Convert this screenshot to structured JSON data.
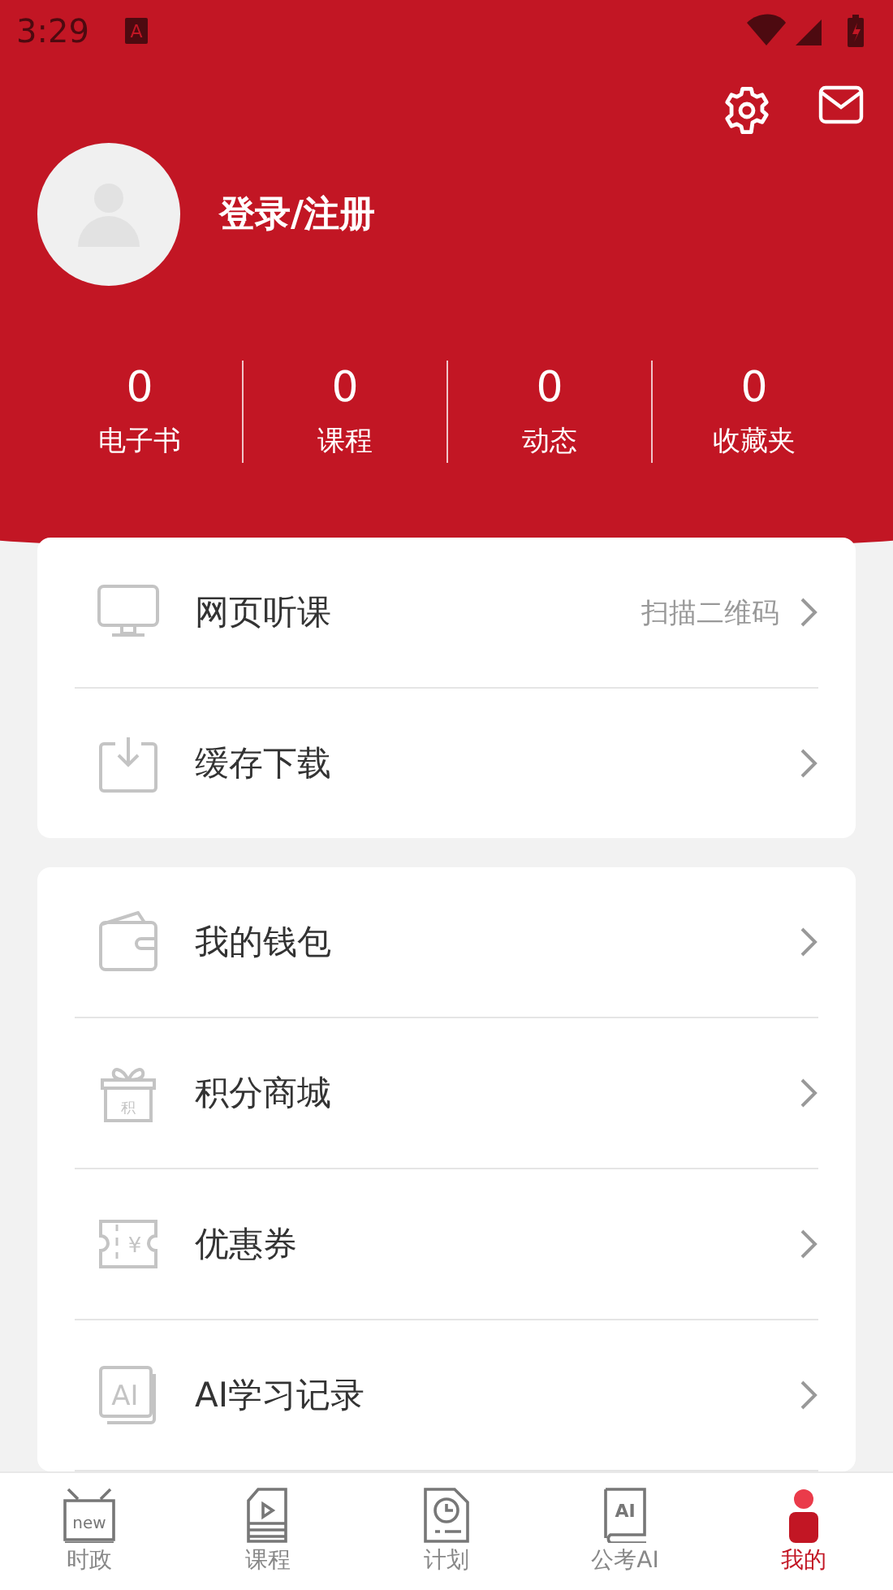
{
  "status_bar": {
    "time": "3:29",
    "notification_icon_text": "A"
  },
  "header": {
    "login_label": "登录/注册"
  },
  "stats": [
    {
      "value": "0",
      "label": "电子书"
    },
    {
      "value": "0",
      "label": "课程"
    },
    {
      "value": "0",
      "label": "动态"
    },
    {
      "value": "0",
      "label": "收藏夹"
    }
  ],
  "menu_groups": [
    [
      {
        "kind": "monitor",
        "label": "网页听课",
        "hint": "扫描二维码"
      },
      {
        "kind": "download",
        "label": "缓存下载"
      }
    ],
    [
      {
        "kind": "wallet",
        "label": "我的钱包"
      },
      {
        "kind": "gift",
        "label": "积分商城",
        "icon_text": "积"
      },
      {
        "kind": "coupon",
        "label": "优惠券",
        "icon_text": "¥"
      },
      {
        "kind": "ai",
        "label": "AI学习记录",
        "icon_text": "AI"
      }
    ]
  ],
  "bottom_nav": [
    {
      "kind": "tv",
      "label": "时政",
      "icon_text": "new",
      "selected": false
    },
    {
      "kind": "course",
      "label": "课程",
      "selected": false
    },
    {
      "kind": "plan",
      "label": "计划",
      "selected": false
    },
    {
      "kind": "book",
      "label": "公考AI",
      "icon_text": "AI",
      "selected": false
    },
    {
      "kind": "person",
      "label": "我的",
      "selected": true
    }
  ]
}
